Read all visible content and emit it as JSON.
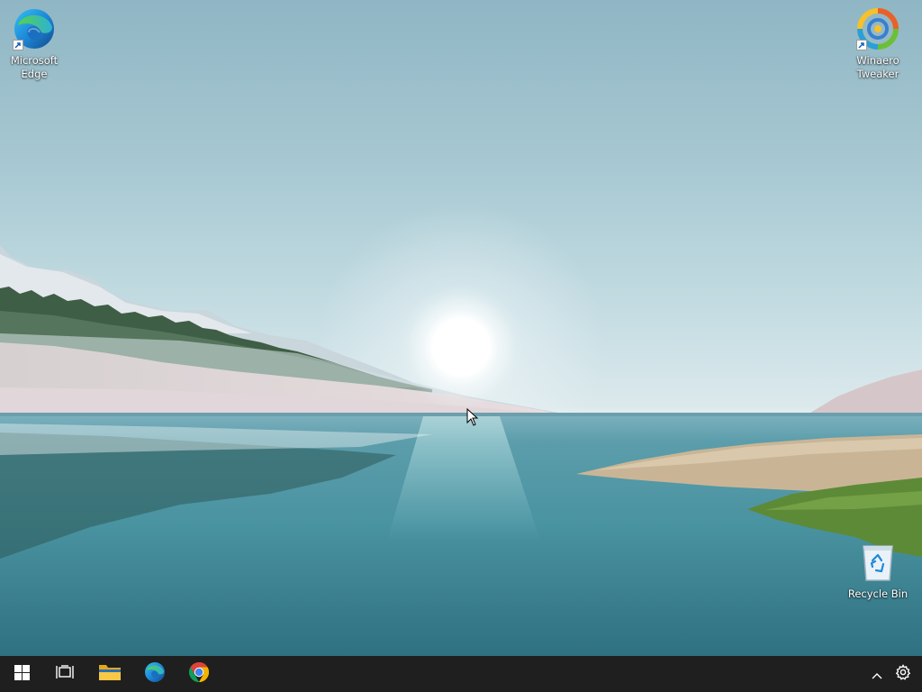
{
  "desktop": {
    "icons": [
      {
        "label": "Microsoft\nEdge",
        "icon": "edge-icon"
      },
      {
        "label": "Winaero\nTweaker",
        "icon": "winaero-tweaker-icon"
      },
      {
        "label": "Recycle Bin",
        "icon": "recycle-bin-icon"
      }
    ]
  },
  "taskbar": {
    "buttons": [
      {
        "name": "start",
        "icon": "windows-logo-icon"
      },
      {
        "name": "task-view",
        "icon": "task-view-icon"
      },
      {
        "name": "file-explorer",
        "icon": "folder-icon"
      },
      {
        "name": "microsoft-edge",
        "icon": "edge-icon"
      },
      {
        "name": "google-chrome",
        "icon": "chrome-icon"
      }
    ],
    "tray": [
      {
        "name": "show-hidden-icons",
        "icon": "chevron-up-icon"
      },
      {
        "name": "settings",
        "icon": "gear-icon"
      }
    ]
  },
  "colors": {
    "taskbar": "#1f1f1f",
    "sky": "#a7c8d2",
    "water": "#3f8a98"
  }
}
